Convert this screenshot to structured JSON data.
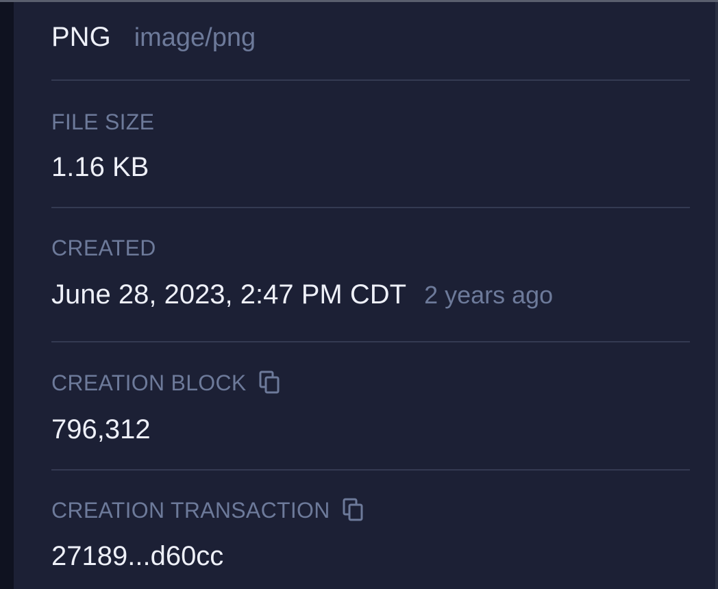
{
  "content_type": {
    "format": "PNG",
    "mime": "image/png"
  },
  "file_size": {
    "label": "FILE SIZE",
    "value": "1.16 KB"
  },
  "created": {
    "label": "CREATED",
    "value": "June 28, 2023, 2:47 PM CDT",
    "relative": "2 years ago"
  },
  "creation_block": {
    "label": "CREATION BLOCK",
    "value": "796,312",
    "copy_icon": "copy-icon"
  },
  "creation_transaction": {
    "label": "CREATION TRANSACTION",
    "value": "27189...d60cc",
    "copy_icon": "copy-icon"
  },
  "colors": {
    "background": "#1c2035",
    "label": "#6d7a9a",
    "value": "#eef0f8",
    "divider": "#343a52"
  }
}
